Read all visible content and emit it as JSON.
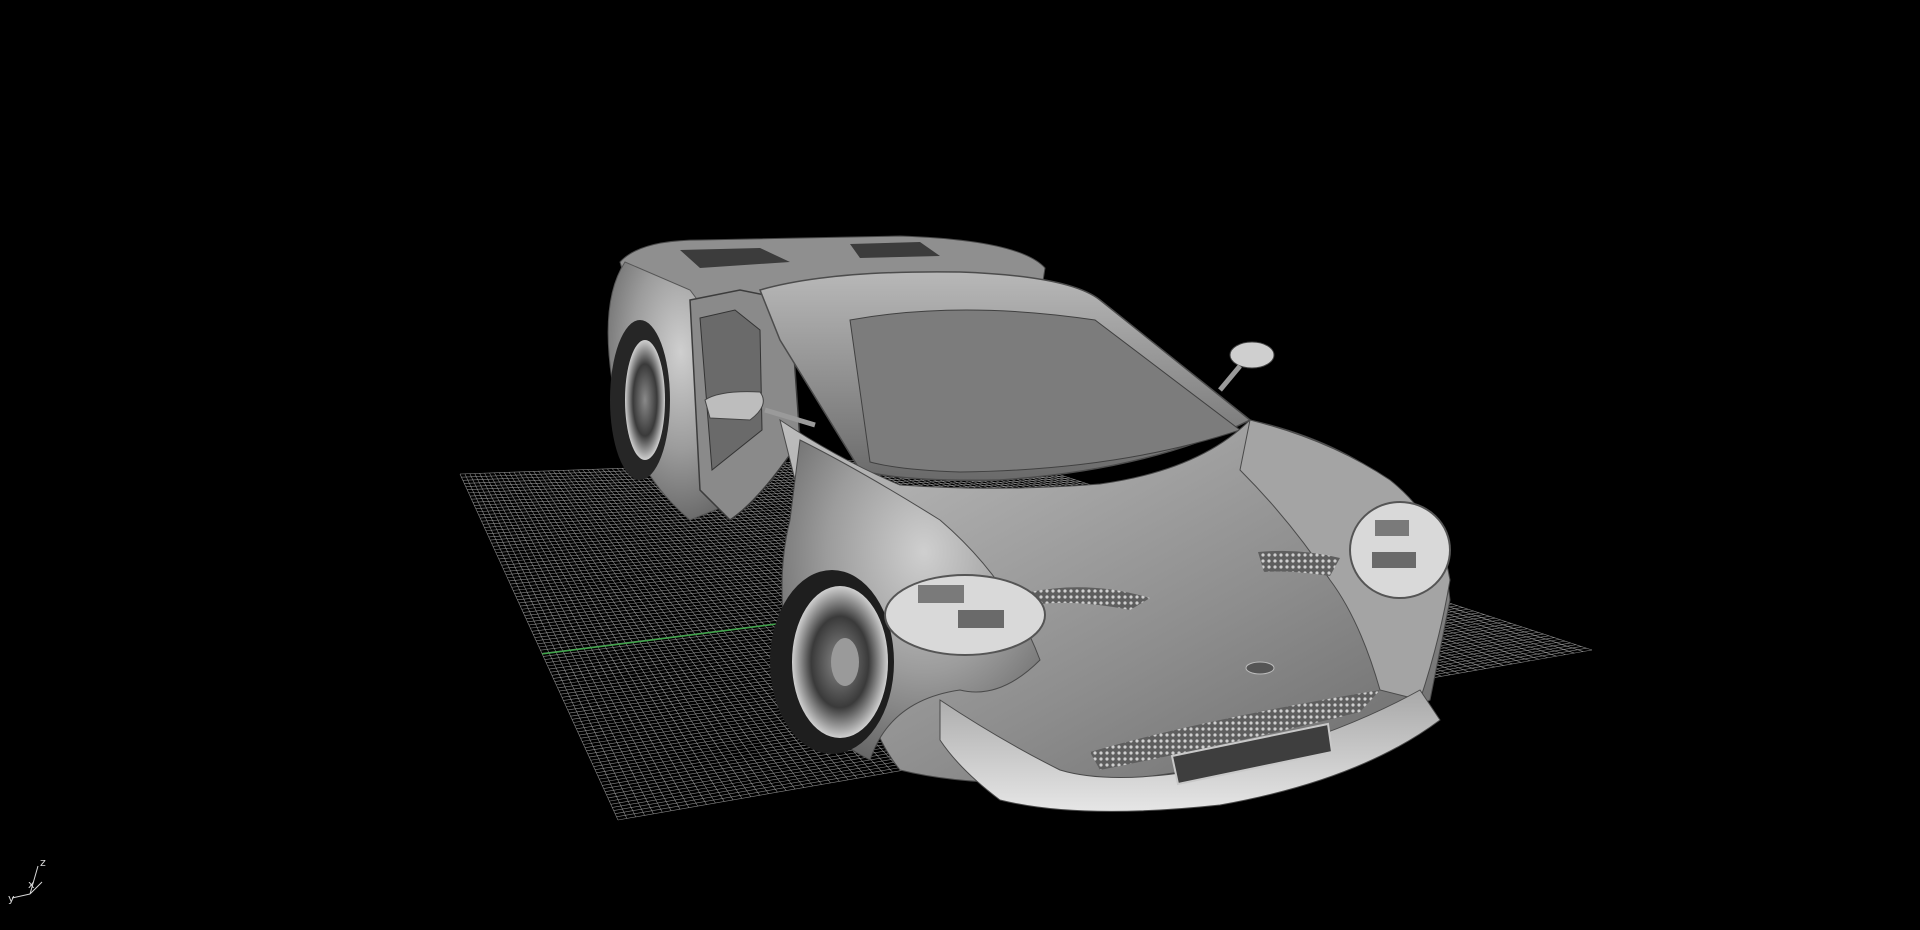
{
  "viewport": {
    "background": "#000000",
    "display_mode": "shaded",
    "model": "sports-car"
  },
  "grid": {
    "color": "#a9a9a9",
    "x_axis_color": "#3fa64a",
    "y_axis_color": "#3fa64a"
  },
  "axis_triad": {
    "labels": {
      "x": "x",
      "y": "y",
      "z": "z"
    },
    "color": "#d9d9d9"
  }
}
